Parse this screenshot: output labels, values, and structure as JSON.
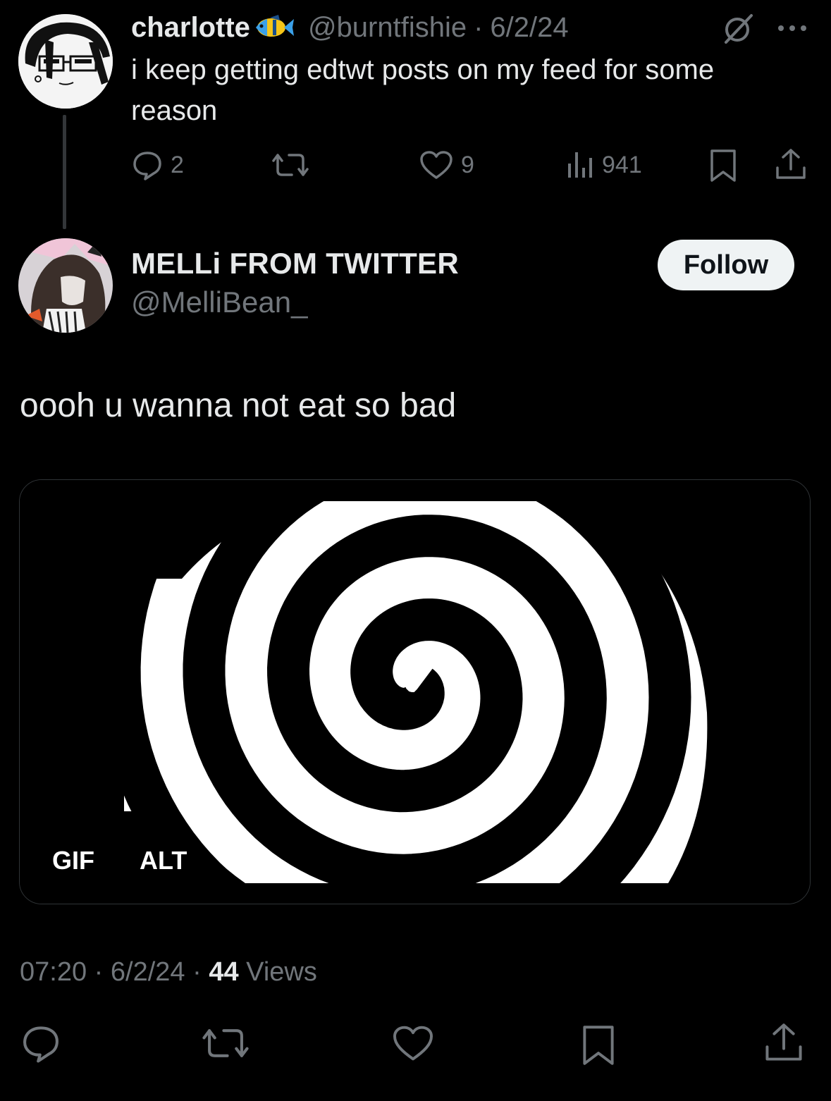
{
  "parent_tweet": {
    "display_name": "charlotte",
    "name_emoji": "tropical-fish-emoji",
    "handle": "@burntfishie",
    "separator": "·",
    "date": "6/2/24",
    "text": "i keep getting edtwt posts on my feed for some reason",
    "replies": "2",
    "retweets": "",
    "likes": "9",
    "views": "941"
  },
  "main_tweet": {
    "display_name": "MELLi FROM TWITTER",
    "handle": "@MelliBean_",
    "follow_label": "Follow",
    "text": "oooh u wanna not eat so bad",
    "media": {
      "type_badge": "GIF",
      "alt_badge": "ALT",
      "description_icon": "hypnotic-spiral-image"
    },
    "time": "07:20",
    "sep1": "·",
    "date": "6/2/24",
    "sep2": "·",
    "views_count": "44",
    "views_label": "Views"
  },
  "colors": {
    "background": "#000000",
    "primary_text": "#e7e9ea",
    "secondary_text": "#71767b",
    "follow_bg": "#eff3f4",
    "follow_text": "#0f1419",
    "border": "#2f3336"
  }
}
